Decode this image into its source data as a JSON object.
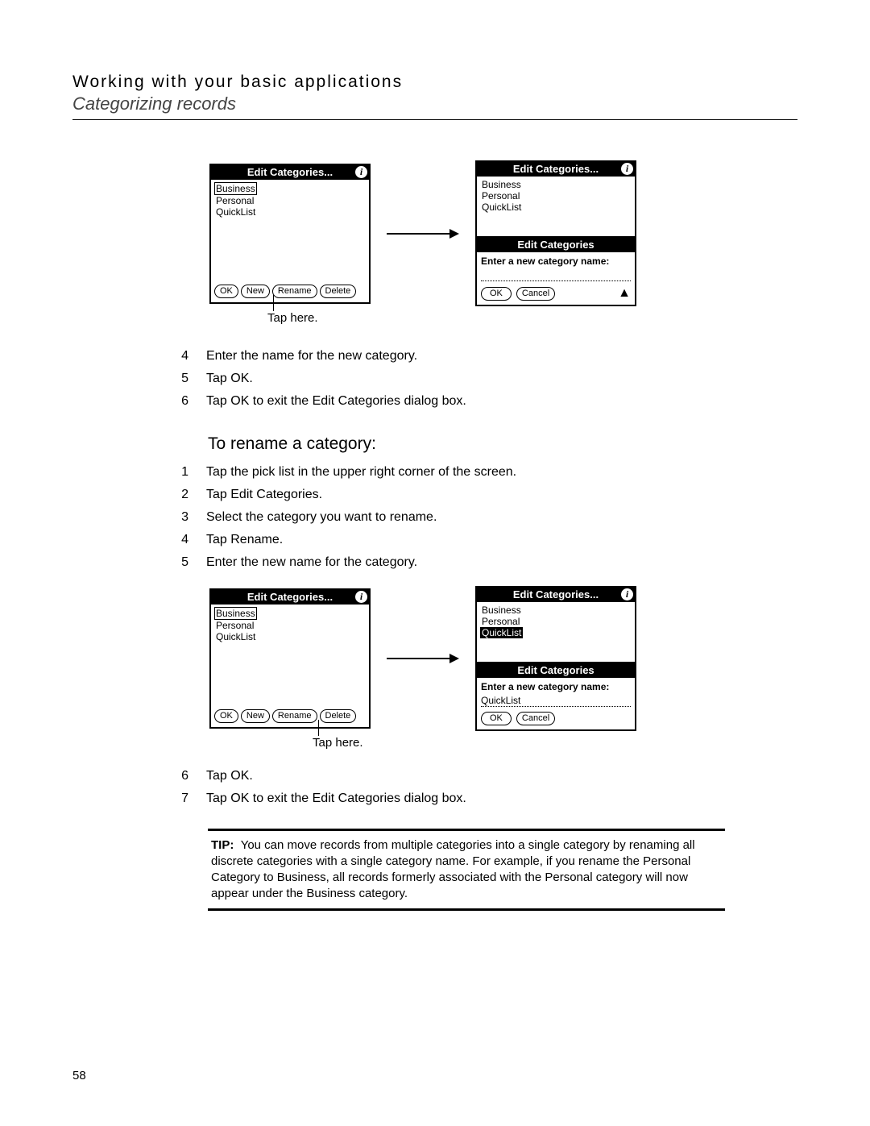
{
  "header": {
    "breadcrumb": "Working with your basic applications",
    "subtitle": "Categorizing records"
  },
  "figure1": {
    "left": {
      "title": "Edit Categories...",
      "items": [
        "Business",
        "Personal",
        "QuickList"
      ],
      "buttons": {
        "ok": "OK",
        "new": "New",
        "rename": "Rename",
        "delete": "Delete"
      }
    },
    "right": {
      "title": "Edit Categories...",
      "items": [
        "Business",
        "Personal",
        "QuickList"
      ],
      "sub": {
        "title": "Edit Categories",
        "prompt": "Enter a new category name:",
        "value": "",
        "ok": "OK",
        "cancel": "Cancel"
      }
    },
    "tap_label": "Tap here."
  },
  "steps1": [
    {
      "n": "4",
      "t": "Enter the name for the new category."
    },
    {
      "n": "5",
      "t": "Tap OK."
    },
    {
      "n": "6",
      "t": "Tap OK to exit the Edit Categories dialog box."
    }
  ],
  "section_heading": "To rename a category:",
  "steps2": [
    {
      "n": "1",
      "t": "Tap the pick list in the upper right corner of the screen."
    },
    {
      "n": "2",
      "t": "Tap Edit Categories."
    },
    {
      "n": "3",
      "t": "Select the category you want to rename."
    },
    {
      "n": "4",
      "t": "Tap Rename."
    },
    {
      "n": "5",
      "t": "Enter the new name for the category."
    }
  ],
  "figure2": {
    "left": {
      "title": "Edit Categories...",
      "items": [
        "Business",
        "Personal",
        "QuickList"
      ],
      "buttons": {
        "ok": "OK",
        "new": "New",
        "rename": "Rename",
        "delete": "Delete"
      }
    },
    "right": {
      "title": "Edit Categories...",
      "items": [
        "Business",
        "Personal",
        "QuickList"
      ],
      "selected_index": 2,
      "sub": {
        "title": "Edit Categories",
        "prompt": "Enter a new category name:",
        "value": "QuickList",
        "ok": "OK",
        "cancel": "Cancel"
      }
    },
    "tap_label": "Tap here."
  },
  "steps3": [
    {
      "n": "6",
      "t": "Tap OK."
    },
    {
      "n": "7",
      "t": "Tap OK to exit the Edit Categories dialog box."
    }
  ],
  "tip": {
    "label": "TIP:",
    "body": "You can move records from multiple categories into a single category by renaming all discrete categories with a single category name. For example, if you rename the Personal Category to Business, all records formerly associated with the Personal category will now appear under the Business category."
  },
  "page_number": "58",
  "arrow_glyph": "▲"
}
